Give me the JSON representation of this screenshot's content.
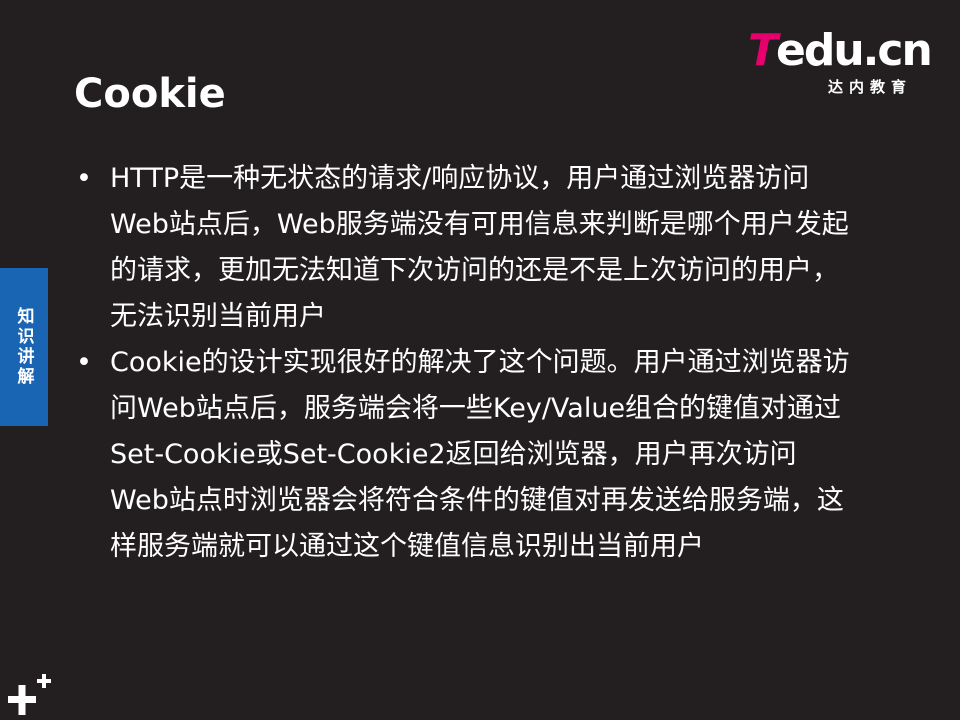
{
  "logo": {
    "t": "T",
    "rest": "edu.cn",
    "subtitle": "达内教育"
  },
  "slide": {
    "title": "Cookie",
    "side_tab": "知识讲解",
    "bullets": [
      "HTTP是一种无状态的请求/响应协议，用户通过浏览器访问Web站点后，Web服务端没有可用信息来判断是哪个用户发起的请求，更加无法知道下次访问的还是不是上次访问的用户，无法识别当前用户",
      "Cookie的设计实现很好的解决了这个问题。用户通过浏览器访问Web站点后，服务端会将一些Key/Value组合的键值对通过Set-Cookie或Set-Cookie2返回给浏览器，用户再次访问Web站点时浏览器会将符合条件的键值对再发送给服务端，这样服务端就可以通过这个键值信息识别出当前用户"
    ],
    "bullet_symbol": "•"
  },
  "colors": {
    "background": "#231f20",
    "brand_pink": "#e5006e",
    "side_tab": "#1a64b4",
    "text": "#ffffff"
  },
  "icons": {
    "corner": "plus-icon"
  }
}
